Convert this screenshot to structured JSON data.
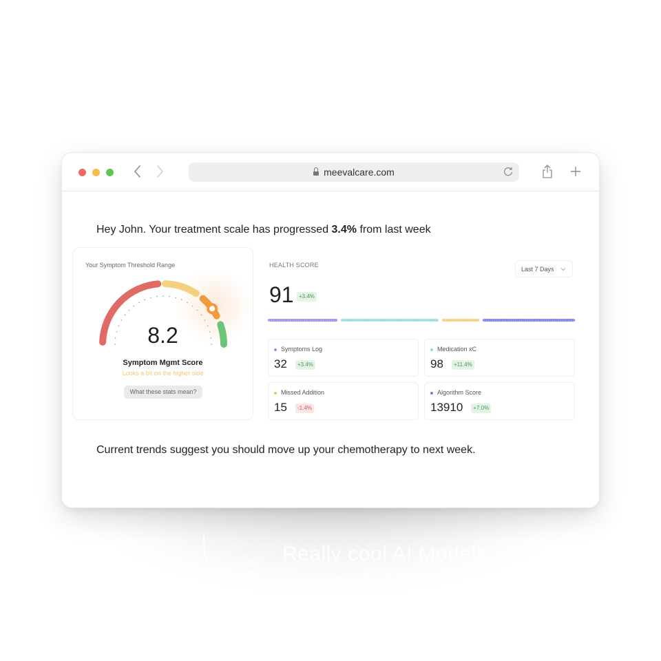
{
  "browser": {
    "url": "meevalcare.com",
    "traffic_lights": [
      "#ee6a5f",
      "#f5bd4f",
      "#61c554"
    ],
    "icons": [
      "back-icon",
      "forward-icon",
      "lock-icon",
      "reload-icon",
      "share-icon",
      "new-tab-icon"
    ]
  },
  "page": {
    "greeting_prefix": "Hey John. Your treatment scale has progressed ",
    "greeting_bold": "3.4%",
    "greeting_suffix": " from last week",
    "footer": "Current trends suggest you should move up your chemotherapy to next week."
  },
  "threshold_card": {
    "title": "Your Symptom Threshold Range",
    "score": "8.2",
    "score_label": "Symptom Mgmt Score",
    "score_note": "Looks a bit on the higher side",
    "button": "What these stats mean?",
    "gauge": {
      "segments": [
        {
          "name": "red",
          "color": "#e06b66"
        },
        {
          "name": "yellow",
          "color": "#f5d07f"
        },
        {
          "name": "orange",
          "color": "#ef9a3c"
        },
        {
          "name": "green",
          "color": "#6cc47a"
        }
      ],
      "indicator_color": "#ef9a3c"
    }
  },
  "health_score": {
    "title": "HEALTH SCORE",
    "range_select": "Last 7 Days",
    "value": "91",
    "change": "+3.4%",
    "bar_colors": [
      "#a393f0",
      "#9fe0df",
      "#f5d07f",
      "#7f86ea"
    ],
    "metrics": [
      {
        "label": "Symptoms Log",
        "value": "32",
        "change": "+3.4%",
        "trend": "pos",
        "dot": "#9b8cf0"
      },
      {
        "label": "Medication xC",
        "value": "98",
        "change": "+11.4%",
        "trend": "pos",
        "dot": "#8fd9d5"
      },
      {
        "label": "Missed Addition",
        "value": "15",
        "change": "-1.4%",
        "trend": "neg",
        "dot": "#f5c461"
      },
      {
        "label": "Algorithm Score",
        "value": "13910",
        "change": "+7.0%",
        "trend": "pos",
        "dot": "#6f78e8"
      }
    ]
  },
  "caption": {
    "line1": "Really cool AI Models",
    "line2": "working behind the scenes."
  }
}
